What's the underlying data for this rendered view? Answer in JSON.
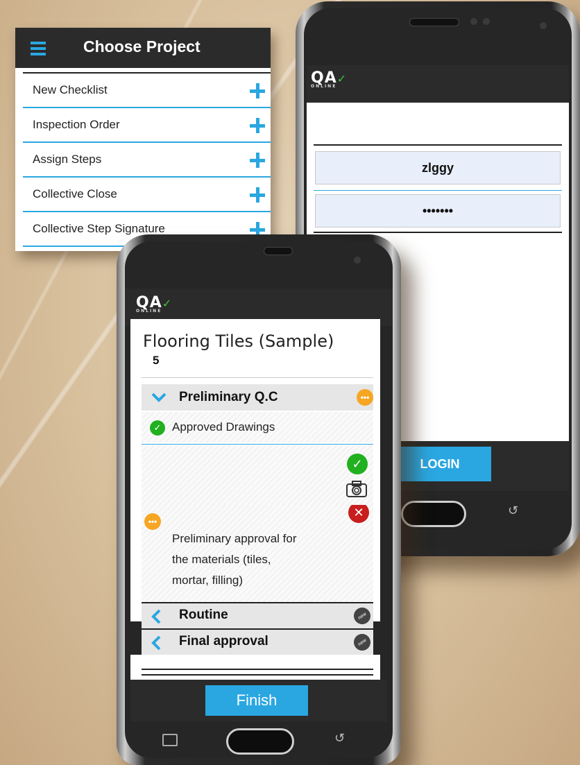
{
  "menu": {
    "title": "Choose Project",
    "items": [
      {
        "label": "New Checklist"
      },
      {
        "label": "Inspection Order"
      },
      {
        "label": "Assign Steps"
      },
      {
        "label": "Collective Close"
      },
      {
        "label": "Collective Step Signature"
      }
    ]
  },
  "logo": {
    "text": "QA",
    "subtext": "ONLINE"
  },
  "login": {
    "username": "zlggy",
    "password": "•••••••",
    "button_label": "LOGIN"
  },
  "checklist": {
    "title": "Flooring Tiles (Sample)",
    "count": "5",
    "sections": [
      {
        "title": "Preliminary Q.C",
        "expanded": true,
        "badge": "more"
      },
      {
        "title": "Routine",
        "expanded": false,
        "badge": "new"
      },
      {
        "title": "Final approval",
        "expanded": false,
        "badge": "new"
      }
    ],
    "step_label": "Approved Drawings",
    "step_description": [
      "Preliminary approval for",
      "the materials (tiles,",
      "mortar, filling)"
    ],
    "badge_new_text": "new",
    "badge_more_text": "•••",
    "finish_label": "Finish"
  },
  "colors": {
    "accent": "#2aa7e1",
    "appbar": "#2b2b2b",
    "ok": "#20b020",
    "reject": "#c81e1e",
    "more": "#f6a623"
  }
}
